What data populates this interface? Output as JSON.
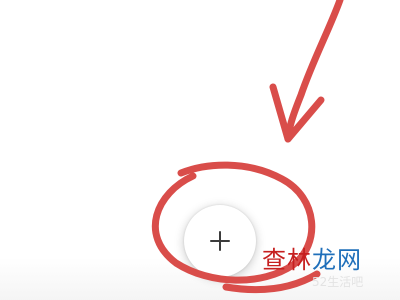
{
  "page": {
    "background_color": "#ffffff"
  },
  "fab": {
    "icon": "plus-icon",
    "background_color": "#ffffff",
    "icon_color": "#3c3c3c"
  },
  "annotation": {
    "shape": "hand-drawn arrow and circle",
    "color": "#d94d4a"
  },
  "watermark": {
    "logo_part1": "查林",
    "logo_part2": "龙网",
    "site": "52生活吧"
  }
}
